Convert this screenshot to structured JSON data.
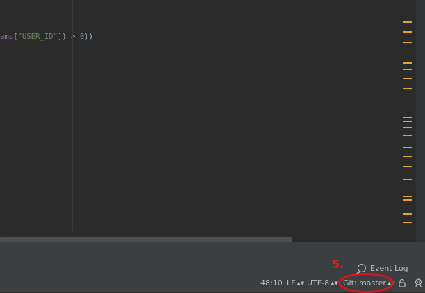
{
  "editor": {
    "code_tokens": [
      {
        "text": "ams",
        "kind": "name"
      },
      {
        "text": "[",
        "kind": "op"
      },
      {
        "text": "\"USER_ID\"",
        "kind": "str"
      },
      {
        "text": "]) > ",
        "kind": "op"
      },
      {
        "text": "0",
        "kind": "num"
      },
      {
        "text": "))",
        "kind": "op"
      }
    ]
  },
  "status_bar": {
    "event_log_label": "Event Log",
    "caret_position": "48:10",
    "line_separator": "LF",
    "encoding": "UTF-8",
    "vcs_branch": "Git: master"
  },
  "annotation": {
    "step_number": "5.",
    "color": "#d9151c"
  },
  "colors": {
    "warning_stripe": "#e4a625",
    "editor_background": "#2b2b2b",
    "status_background": "#3c3f41"
  }
}
